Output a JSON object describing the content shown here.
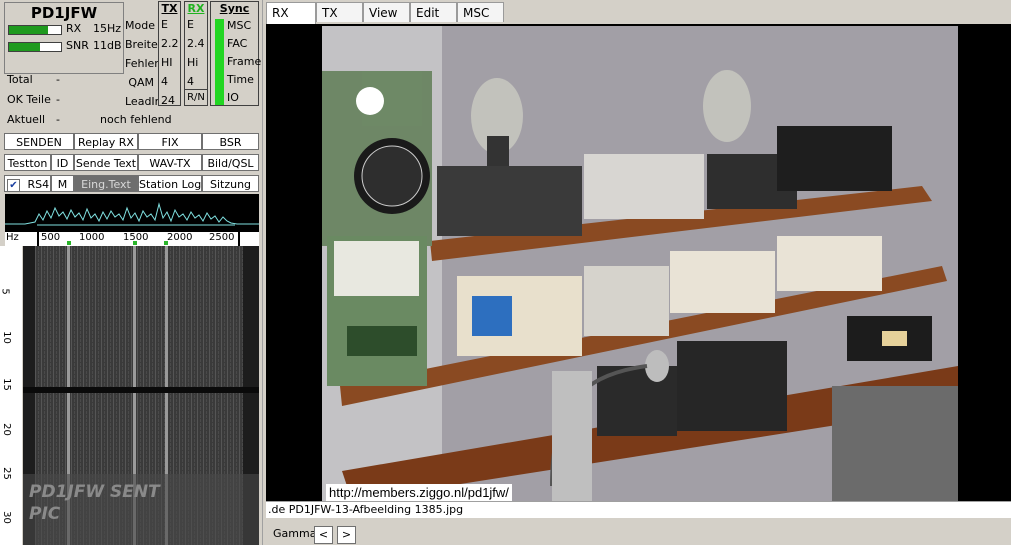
{
  "station": {
    "callsign": "PD1JFW",
    "rx_label": "RX",
    "rx_value": "15Hz",
    "snr_label": "SNR",
    "snr_value": "11dB",
    "rx_meter": 0.75,
    "snr_meter": 0.6
  },
  "stats": {
    "total_label": "Total",
    "total_value": "-",
    "ok_label": "OK Teile",
    "ok_value": "-",
    "aktuell_label": "Aktuell",
    "aktuell_value": "-",
    "missing": "noch fehlend"
  },
  "mode_labels": [
    "Mode",
    "Breite",
    "Fehler",
    "QAM",
    "LeadIn"
  ],
  "tx": {
    "header": "TX",
    "values": [
      "E",
      "2.2",
      "HI",
      "4",
      "24"
    ]
  },
  "rx": {
    "header": "RX",
    "values": [
      "E",
      "2.4",
      "Hi",
      "4",
      "R/N"
    ]
  },
  "sync": {
    "header": "Sync",
    "items": [
      "MSC",
      "FAC",
      "Frame",
      "Time",
      "IO"
    ],
    "color": "#22d622"
  },
  "buttons": {
    "senden": "SENDEN",
    "replay_rx": "Replay RX",
    "fix": "FIX",
    "bsr": "BSR",
    "testton": "Testton",
    "id": "ID",
    "sende_text": "Sende Text",
    "wav_tx": "WAV-TX",
    "bild_qsl": "Bild/QSL",
    "rs4": "RS4",
    "m": "M",
    "eing_text": "Eing.Text",
    "station_log": "Station Log",
    "sitzung": "Sitzung"
  },
  "spectrum": {
    "hz_label": "Hz",
    "ticks": [
      "500",
      "1000",
      "1500",
      "2000",
      "2500"
    ]
  },
  "waterfall": {
    "axis_labels": [
      "5",
      "10",
      "15",
      "20",
      "25",
      "30"
    ],
    "overlay_line1": "PD1JFW SENT",
    "overlay_line2": "PIC"
  },
  "tabs": [
    "RX",
    "TX",
    "View",
    "Edit",
    "MSC"
  ],
  "image": {
    "url_caption": "http://members.ziggo.nl/pd1jfw/",
    "filename": ".de PD1JFW-13-Afbeelding 1385.jpg"
  },
  "gamma": {
    "label": "Gamma",
    "prev": "<",
    "next": ">"
  }
}
